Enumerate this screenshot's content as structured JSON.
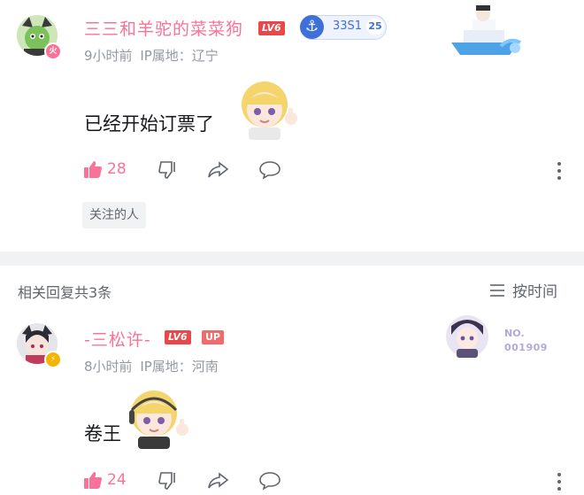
{
  "comment": {
    "username": "三三和羊驼的菜菜狗",
    "level": "LV6",
    "fan_badge": {
      "icon": "anchor-icon",
      "label": "33S1",
      "level": "25"
    },
    "avatar_badge_icon": "fire-icon",
    "time": "9小时前",
    "ip": "IP属地：辽宁",
    "text": "已经开始订票了",
    "likes": "28",
    "tag": "关注的人"
  },
  "replies_header": {
    "count_label": "相关回复共3条",
    "sort_label": "按时间"
  },
  "reply": {
    "username": "-三松许-",
    "level": "LV6",
    "up_badge": "UP",
    "avatar_badge_icon": "lightning-icon",
    "time": "8小时前",
    "ip": "IP属地：河南",
    "text": "卷王",
    "likes": "24",
    "card_no_label": "NO.",
    "card_no_value": "001909"
  },
  "colors": {
    "accent_pink": "#fb7299",
    "level_red": "#e8484a",
    "meta_gray": "#9499a0",
    "fan_badge_blue": "#3f6fd8"
  }
}
